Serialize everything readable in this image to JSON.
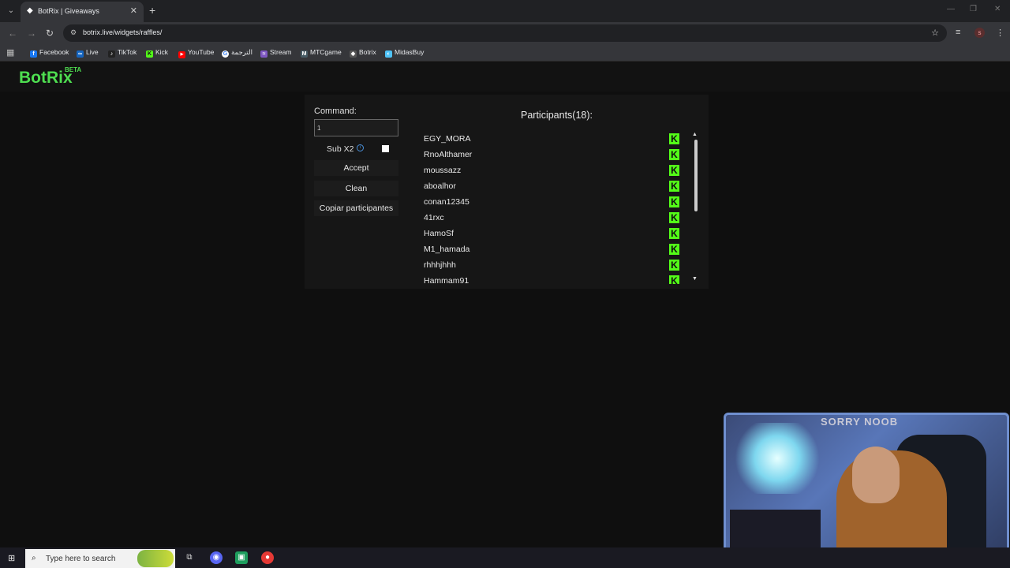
{
  "browser": {
    "tab_title": "BotRix | Giveaways",
    "url": "botrix.live/widgets/raffles/",
    "profile_initial": "s",
    "bookmarks": [
      {
        "label": "Facebook",
        "color": "#1877f2",
        "glyph": "f"
      },
      {
        "label": "Live",
        "color": "#1565c0",
        "glyph": "∞"
      },
      {
        "label": "TikTok",
        "color": "#222222",
        "glyph": "♪"
      },
      {
        "label": "Kick",
        "color": "#53fc18",
        "glyph": "K"
      },
      {
        "label": "YouTube",
        "color": "#ff0000",
        "glyph": "▶"
      },
      {
        "label": "الترجمة",
        "color": "#4285f4",
        "glyph": "G"
      },
      {
        "label": "Stream",
        "color": "#7e57c2",
        "glyph": "≈"
      },
      {
        "label": "MTCgame",
        "color": "#455a64",
        "glyph": "M"
      },
      {
        "label": "Botrix",
        "color": "#555555",
        "glyph": "◆"
      },
      {
        "label": "MidasBuy",
        "color": "#4fc3f7",
        "glyph": "◐"
      }
    ]
  },
  "site": {
    "logo": "BotRix",
    "logo_badge": "BETA"
  },
  "raffle": {
    "command_label": "Command:",
    "command_value": "1",
    "sub_label": "Sub X2",
    "sub_checked": false,
    "accept_label": "Accept",
    "clean_label": "Clean",
    "copy_label": "Copiar participantes",
    "participants_title": "Participants(18):",
    "participants": [
      "EGY_MORA",
      "RnoAlthamer",
      "moussazz",
      "aboalhor",
      "conan12345",
      "41rxc",
      "HamoSf",
      "M1_hamada",
      "rhhhjhhh",
      "Hammam91"
    ],
    "platform_badge": "K"
  },
  "webcam": {
    "sign_text": "SORRY NOOB"
  },
  "taskbar": {
    "search_placeholder": "Type here to search"
  },
  "colors": {
    "accent_green": "#4ede50",
    "kick_green": "#53fc18"
  }
}
